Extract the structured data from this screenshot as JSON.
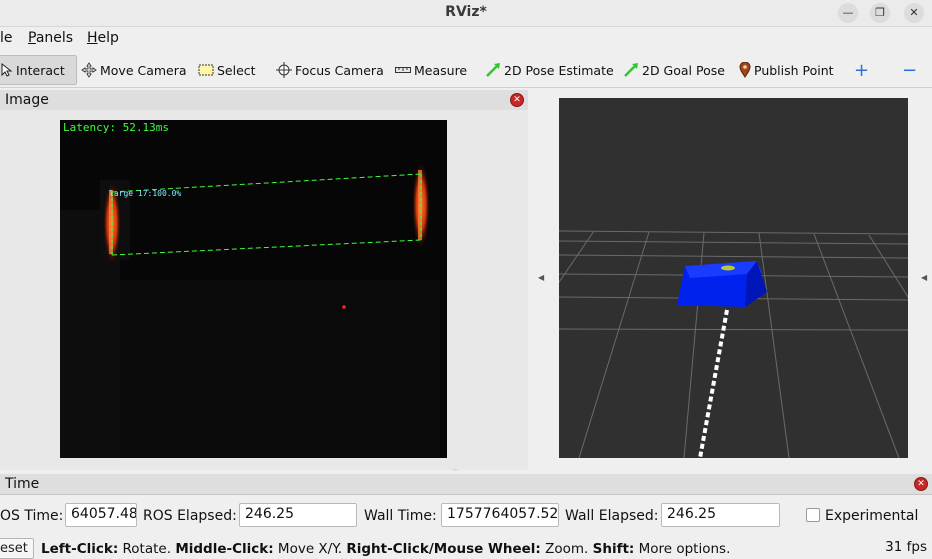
{
  "window": {
    "title": "RViz*"
  },
  "menu": {
    "file": "le",
    "panels": "Panels",
    "help": "Help"
  },
  "toolbar": {
    "interact": "Interact",
    "move_camera": "Move Camera",
    "select": "Select",
    "focus_camera": "Focus Camera",
    "measure": "Measure",
    "pose_estimate": "2D Pose Estimate",
    "goal_pose": "2D Goal Pose",
    "publish_point": "Publish Point"
  },
  "image_panel": {
    "title": "Image",
    "overlay": {
      "latency": "Latency: 52.13ms",
      "detection": "large 17:100.0%"
    }
  },
  "time_panel": {
    "title": "Time",
    "ros_time_label": "OS Time:",
    "ros_time_value": "64057.48",
    "ros_elapsed_label": "ROS Elapsed:",
    "ros_elapsed_value": "246.25",
    "wall_time_label": "Wall Time:",
    "wall_time_value": "1757764057.52",
    "wall_elapsed_label": "Wall Elapsed:",
    "wall_elapsed_value": "246.25",
    "experimental_label": "Experimental"
  },
  "status": {
    "reset_label": "eset",
    "hint_left_click": "Left-Click:",
    "hint_rotate": " Rotate. ",
    "hint_middle_click": "Middle-Click:",
    "hint_move": " Move X/Y. ",
    "hint_right_click": "Right-Click/Mouse Wheel:",
    "hint_zoom": " Zoom. ",
    "hint_shift": "Shift:",
    "hint_more": " More options.",
    "fps": "31 fps"
  },
  "colors": {
    "overlay_green": "#3cff3c",
    "overlay_cyan": "#7ff0ff",
    "marker_blue": "#0022ee",
    "viewport_bg": "#303030",
    "close_red": "#c62828"
  }
}
